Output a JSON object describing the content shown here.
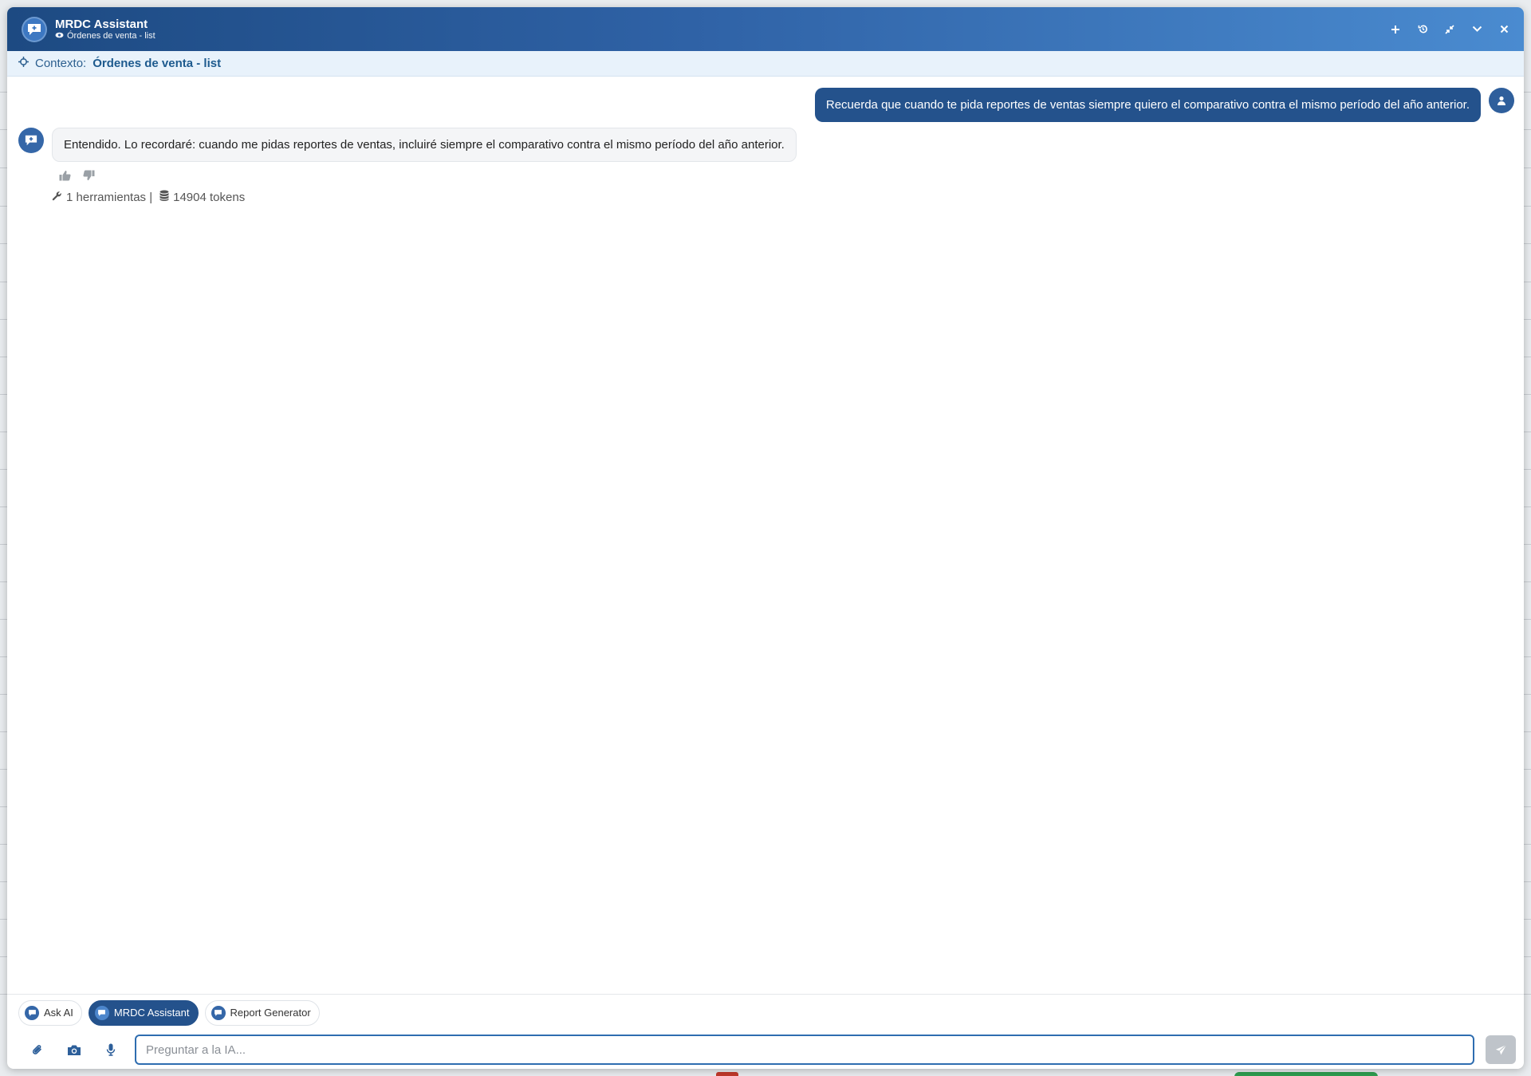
{
  "window": {
    "title": "MRDC Assistant",
    "subtitle": "Órdenes de venta - list",
    "actions": [
      "plus-icon",
      "history-icon",
      "compress-icon",
      "chevron-down-icon",
      "close-icon"
    ]
  },
  "context": {
    "label": "Contexto:",
    "value": "Órdenes de venta - list"
  },
  "messages": {
    "user_text": "Recuerda que cuando te pida reportes de ventas siempre quiero el comparativo contra el mismo período del año anterior.",
    "assistant_text": "Entendido. Lo recordaré: cuando me pidas reportes de ventas, incluiré siempre el comparativo contra el mismo período del año anterior.",
    "tools_count": "1 herramientas |",
    "tokens": "14904 tokens"
  },
  "agent_tabs": [
    {
      "label": "Ask AI",
      "active": false
    },
    {
      "label": "MRDC Assistant",
      "active": true
    },
    {
      "label": "Report Generator",
      "active": false
    }
  ],
  "input": {
    "placeholder": "Preguntar a la IA..."
  },
  "colors": {
    "header_start": "#1d4a82",
    "header_end": "#4a8bd0",
    "user_bubble": "#24528c",
    "context_bg": "#e8f2fb"
  }
}
